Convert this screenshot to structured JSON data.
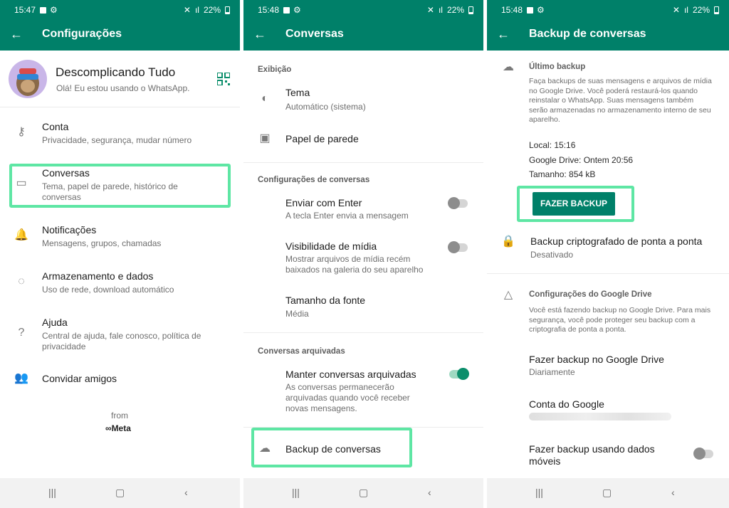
{
  "colors": {
    "brand": "#008069",
    "highlight": "#5ee6a4",
    "toggle_on": "#0b8e6b"
  },
  "panel1": {
    "status": {
      "time": "15:47",
      "battery": "22%"
    },
    "title": "Configurações",
    "profile": {
      "name": "Descomplicando Tudo",
      "about": "Olá! Eu estou usando o WhatsApp."
    },
    "items": [
      {
        "icon": "key-icon",
        "title": "Conta",
        "subtitle": "Privacidade, segurança, mudar número"
      },
      {
        "icon": "chat-icon",
        "title": "Conversas",
        "subtitle": "Tema, papel de parede, histórico de conversas"
      },
      {
        "icon": "bell-icon",
        "title": "Notificações",
        "subtitle": "Mensagens, grupos, chamadas"
      },
      {
        "icon": "storage-icon",
        "title": "Armazenamento e dados",
        "subtitle": "Uso de rede, download automático"
      },
      {
        "icon": "help-icon",
        "title": "Ajuda",
        "subtitle": "Central de ajuda, fale conosco, política de privacidade"
      },
      {
        "icon": "people-icon",
        "title": "Convidar amigos",
        "subtitle": ""
      }
    ],
    "footer_from": "from",
    "footer_brand": "Meta"
  },
  "panel2": {
    "status": {
      "time": "15:48",
      "battery": "22%"
    },
    "title": "Conversas",
    "sections": {
      "display": "Exibição",
      "chat_settings": "Configurações de conversas",
      "archived": "Conversas arquivadas"
    },
    "theme": {
      "title": "Tema",
      "subtitle": "Automático (sistema)"
    },
    "wallpaper": {
      "title": "Papel de parede"
    },
    "enter_send": {
      "title": "Enviar com Enter",
      "subtitle": "A tecla Enter envia a mensagem",
      "on": false
    },
    "media_visibility": {
      "title": "Visibilidade de mídia",
      "subtitle": "Mostrar arquivos de mídia recém baixados na galeria do seu aparelho",
      "on": false
    },
    "font_size": {
      "title": "Tamanho da fonte",
      "subtitle": "Média"
    },
    "keep_archived": {
      "title": "Manter conversas arquivadas",
      "subtitle": "As conversas permanecerão arquivadas quando você receber novas mensagens.",
      "on": true
    },
    "backup": {
      "title": "Backup de conversas"
    }
  },
  "panel3": {
    "status": {
      "time": "15:48",
      "battery": "22%"
    },
    "title": "Backup de conversas",
    "last_backup": {
      "heading": "Último backup",
      "description": "Faça backups de suas mensagens e arquivos de mídia no Google Drive. Você poderá restaurá-los quando reinstalar o WhatsApp. Suas mensagens também serão armazenadas no armazenamento interno de seu aparelho.",
      "local": "Local: 15:16",
      "gdrive": "Google Drive: Ontem 20:56",
      "size": "Tamanho: 854 kB",
      "button": "FAZER BACKUP"
    },
    "encrypted": {
      "title": "Backup criptografado de ponta a ponta",
      "subtitle": "Desativado"
    },
    "gdrive_settings": {
      "heading": "Configurações do Google Drive",
      "description": "Você está fazendo backup no Google Drive. Para mais segurança, você pode proteger seu backup com a criptografia de ponta a ponta."
    },
    "backup_to_drive": {
      "title": "Fazer backup no Google Drive",
      "subtitle": "Diariamente"
    },
    "google_account": {
      "title": "Conta do Google"
    },
    "mobile_data": {
      "title": "Fazer backup usando dados móveis",
      "on": false
    }
  }
}
